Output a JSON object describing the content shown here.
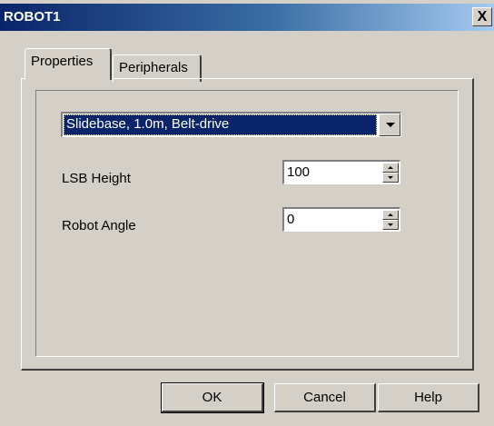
{
  "window": {
    "title": "ROBOT1",
    "close_label": "X"
  },
  "tabs": [
    {
      "label": "Properties",
      "active": true
    },
    {
      "label": "Peripherals",
      "active": false
    }
  ],
  "properties": {
    "base_type": {
      "selected": "Slidebase, 1.0m, Belt-drive"
    },
    "lsb_height": {
      "label": "LSB Height",
      "value": "100"
    },
    "robot_angle": {
      "label": "Robot Angle",
      "value": "0"
    }
  },
  "buttons": {
    "ok": "OK",
    "cancel": "Cancel",
    "help": "Help"
  },
  "colors": {
    "titlebar": "#0a246a",
    "face": "#d4d0c8",
    "selection": "#0a246a"
  }
}
